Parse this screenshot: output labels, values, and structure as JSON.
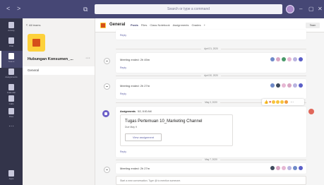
{
  "titlebar": {
    "back": "<",
    "forward": ">",
    "compose": "⧉",
    "search_placeholder": "Search or type a command",
    "min": "–",
    "max": "▢",
    "close": "✕"
  },
  "rail": {
    "items": [
      {
        "label": "Activity",
        "icon": "bell-icon"
      },
      {
        "label": "Chat",
        "icon": "chat-icon"
      },
      {
        "label": "Teams",
        "icon": "teams-icon",
        "active": true
      },
      {
        "label": "Assignments",
        "icon": "assignments-icon"
      },
      {
        "label": "Calendar",
        "icon": "calendar-icon"
      },
      {
        "label": "Calls",
        "icon": "phone-icon"
      },
      {
        "label": "Files",
        "icon": "files-icon"
      }
    ],
    "more": "···",
    "apps_label": "Apps"
  },
  "team_panel": {
    "back_label": "All teams",
    "team_name": "Hubungan Konsumen_...",
    "team_more": "···",
    "channel": "General"
  },
  "header": {
    "channel_name": "General",
    "tabs": [
      "Posts",
      "Files",
      "Class Notebook",
      "Assignments",
      "Grades",
      "+"
    ],
    "team_button": "Team"
  },
  "feed": {
    "top_reply": "Reply",
    "messages": [
      {
        "text": "Meeting ended: 2h 45m",
        "reply": "Reply",
        "date": "April 21, 2020"
      },
      {
        "text": "Meeting ended: 2h 27m",
        "reply": "Reply",
        "date": "April 30, 2020"
      }
    ],
    "assignment_date": "May 2, 2020",
    "assignment": {
      "author": "Assignments",
      "time": "5/2, 8:00 AM",
      "title": "Tugas Pertemuan 10_Marketing Channel",
      "due": "Due May 9",
      "button": "View assignment",
      "reply": "Reply"
    },
    "last_date": "May 7, 2020",
    "last_message": "Meeting ended: 2h 27m"
  },
  "compose": {
    "placeholder": "Start a new conversation. Type @ to mention someone."
  },
  "colors": {
    "titlebar": "#464775",
    "rail": "#33344a",
    "accent": "#6264a7",
    "team_logo": "#fdd13b",
    "team_logo_inner": "#d6501a"
  }
}
